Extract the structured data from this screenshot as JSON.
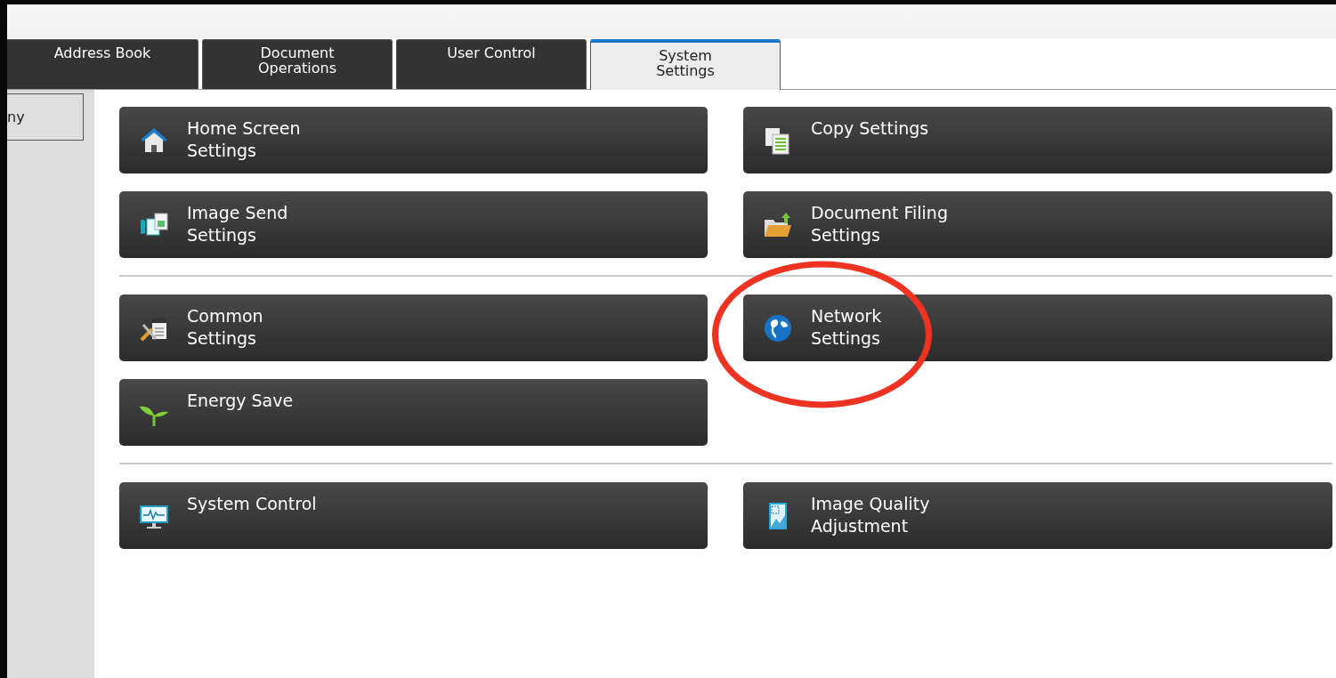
{
  "tabs": [
    {
      "label": "Address Book",
      "selected": false
    },
    {
      "label": "Document\nOperations",
      "selected": false
    },
    {
      "label": "User Control",
      "selected": false
    },
    {
      "label": "System\nSettings",
      "selected": true
    }
  ],
  "sidebar": {
    "items": [
      {
        "label": "ny"
      }
    ]
  },
  "groups": [
    {
      "items": [
        {
          "label": "Home Screen\nSettings",
          "circled": false
        },
        {
          "label": "Copy Settings",
          "circled": false
        },
        {
          "label": "Image Send\nSettings",
          "circled": false
        },
        {
          "label": "Document Filing\nSettings",
          "circled": false
        }
      ]
    },
    {
      "items": [
        {
          "label": "Common\nSettings",
          "circled": false
        },
        {
          "label": "Network\nSettings",
          "circled": true
        },
        {
          "label": "Energy Save",
          "circled": false
        }
      ]
    },
    {
      "items": [
        {
          "label": "System Control",
          "circled": false
        },
        {
          "label": "Image Quality\nAdjustment",
          "circled": false
        }
      ]
    }
  ]
}
